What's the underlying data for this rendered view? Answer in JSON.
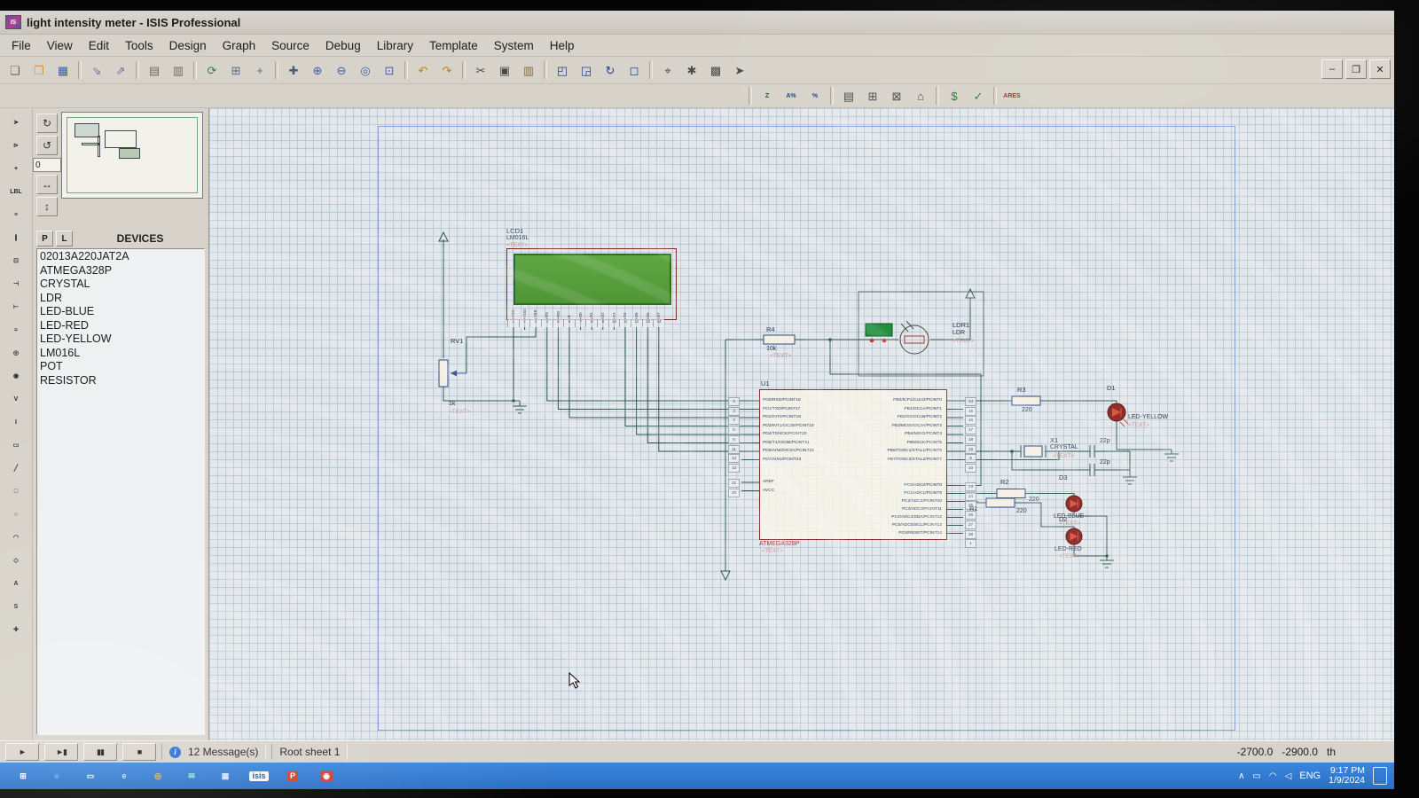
{
  "window": {
    "title": "light intensity meter - ISIS Professional",
    "app_badge": "IS",
    "min": "–",
    "max": "❐",
    "close": "✕"
  },
  "menu": [
    "File",
    "View",
    "Edit",
    "Tools",
    "Design",
    "Graph",
    "Source",
    "Debug",
    "Library",
    "Template",
    "System",
    "Help"
  ],
  "toolbar": {
    "g1": [
      {
        "n": "new-file-icon",
        "g": "❏",
        "c": "#6b675e"
      },
      {
        "n": "open-folder-icon",
        "g": "❐",
        "c": "#c89a35"
      },
      {
        "n": "save-icon",
        "g": "▦",
        "c": "#3f5fae"
      }
    ],
    "g2": [
      {
        "n": "import-icon",
        "g": "⇘",
        "c": "#7d68a8"
      },
      {
        "n": "export-icon",
        "g": "⇗",
        "c": "#7d68a8"
      }
    ],
    "g3": [
      {
        "n": "print-icon",
        "g": "▤",
        "c": "#6f6b61"
      },
      {
        "n": "mark-output-icon",
        "g": "▥",
        "c": "#6f6b61"
      }
    ],
    "g4": [
      {
        "n": "redraw-icon",
        "g": "⟳",
        "c": "#3f7a4f"
      },
      {
        "n": "grid-toggle-icon",
        "g": "⊞",
        "c": "#5a6a8a"
      },
      {
        "n": "false-origin-icon",
        "g": "+",
        "c": "#5a6a8a"
      }
    ],
    "g5": [
      {
        "n": "pan-icon",
        "g": "✚",
        "c": "#4a5a7a"
      },
      {
        "n": "zoom-in-icon",
        "g": "⊕",
        "c": "#3f5fae"
      },
      {
        "n": "zoom-out-icon",
        "g": "⊖",
        "c": "#3f5fae"
      },
      {
        "n": "zoom-all-icon",
        "g": "◎",
        "c": "#3f5fae"
      },
      {
        "n": "zoom-area-icon",
        "g": "⊡",
        "c": "#3f5fae"
      }
    ],
    "g6": [
      {
        "n": "undo-icon",
        "g": "↶",
        "c": "#b8860b"
      },
      {
        "n": "redo-icon",
        "g": "↷",
        "c": "#b8860b"
      }
    ],
    "g7": [
      {
        "n": "cut-icon",
        "g": "✂",
        "c": "#4a4a4a"
      },
      {
        "n": "copy-icon",
        "g": "▣",
        "c": "#4a4a4a"
      },
      {
        "n": "paste-icon",
        "g": "▥",
        "c": "#8a6d3b"
      }
    ],
    "g8": [
      {
        "n": "block-copy-icon",
        "g": "◰",
        "c": "#1f3f8f"
      },
      {
        "n": "block-move-icon",
        "g": "◲",
        "c": "#1f3f8f"
      },
      {
        "n": "block-rotate-icon",
        "g": "↻",
        "c": "#1f3f8f"
      },
      {
        "n": "block-delete-icon",
        "g": "◻",
        "c": "#1f3f8f"
      }
    ],
    "g9": [
      {
        "n": "pick-device-icon",
        "g": "⌖",
        "c": "#4a4a4a"
      },
      {
        "n": "make-device-icon",
        "g": "✱",
        "c": "#4a4a4a"
      },
      {
        "n": "packaging-tool-icon",
        "g": "▩",
        "c": "#4a4a4a"
      },
      {
        "n": "decompose-icon",
        "g": "➤",
        "c": "#4a4a4a"
      }
    ],
    "h1": [
      {
        "n": "wire-autorouter-icon",
        "g": "Z",
        "c": "#1f3f8f"
      },
      {
        "n": "search-tag-icon",
        "g": "A%",
        "c": "#1f3f8f"
      },
      {
        "n": "property-assignment-icon",
        "g": "%",
        "c": "#1f3f8f"
      }
    ],
    "h2": [
      {
        "n": "design-explorer-icon",
        "g": "▤",
        "c": "#4a4a4a"
      },
      {
        "n": "new-sheet-icon",
        "g": "⊞",
        "c": "#4a4a4a"
      },
      {
        "n": "remove-sheet-icon",
        "g": "⊠",
        "c": "#4a4a4a"
      },
      {
        "n": "goto-sheet-icon",
        "g": "⌂",
        "c": "#4a4a4a"
      }
    ],
    "h3": [
      {
        "n": "bill-of-materials-icon",
        "g": "$",
        "c": "#2a7a2a"
      },
      {
        "n": "electrical-check-icon",
        "g": "✓",
        "c": "#2a7a2a"
      }
    ],
    "h4": [
      {
        "n": "netlist-to-ares-icon",
        "g": "ARES",
        "c": "#b22222"
      }
    ]
  },
  "modes": [
    {
      "n": "selection-pointer-mode",
      "g": "➤"
    },
    {
      "n": "component-mode",
      "g": "⊳"
    },
    {
      "n": "junction-dot-mode",
      "g": "+"
    },
    {
      "n": "wire-label-mode",
      "g": "LBL"
    },
    {
      "n": "text-script-mode",
      "g": "≡"
    },
    {
      "n": "bus-mode",
      "g": "∥"
    },
    {
      "n": "subcircuit-mode",
      "g": "⊡"
    },
    {
      "n": "terminal-mode",
      "g": "⊣"
    },
    {
      "n": "device-pin-mode",
      "g": "⊢"
    },
    {
      "n": "graph-mode",
      "g": "≈"
    },
    {
      "n": "tape-recorder-mode",
      "g": "◎"
    },
    {
      "n": "generator-mode",
      "g": "◉"
    },
    {
      "n": "voltage-probe-mode",
      "g": "V"
    },
    {
      "n": "current-probe-mode",
      "g": "I"
    },
    {
      "n": "virtual-instruments-mode",
      "g": "▭"
    },
    {
      "n": "2d-line-mode",
      "g": "╱"
    },
    {
      "n": "2d-box-mode",
      "g": "□"
    },
    {
      "n": "2d-circle-mode",
      "g": "○"
    },
    {
      "n": "2d-arc-mode",
      "g": "◠"
    },
    {
      "n": "2d-path-mode",
      "g": "◇"
    },
    {
      "n": "2d-text-mode",
      "g": "A"
    },
    {
      "n": "2d-symbol-mode",
      "g": "S"
    },
    {
      "n": "marker-mode",
      "g": "✚"
    }
  ],
  "rotate": {
    "cw": "↻",
    "ccw": "↺",
    "angle": "0",
    "mirror_h": "↔",
    "mirror_v": "↕"
  },
  "devices_panel": {
    "p": "P",
    "l": "L",
    "header": "DEVICES",
    "items": [
      "02013A220JAT2A",
      "ATMEGA328P",
      "CRYSTAL",
      "LDR",
      "LED-BLUE",
      "LED-RED",
      "LED-YELLOW",
      "LM016L",
      "POT",
      "RESISTOR"
    ]
  },
  "schematic": {
    "lcd": {
      "ref": "LCD1",
      "value": "LM016L",
      "text": "<TEXT>",
      "pins": [
        {
          "l": "VSS",
          "n": "1"
        },
        {
          "l": "VDD",
          "n": "2"
        },
        {
          "l": "VEE",
          "n": "3"
        },
        {
          "l": "RS",
          "n": "4"
        },
        {
          "l": "RW",
          "n": "5"
        },
        {
          "l": "E",
          "n": "6"
        },
        {
          "l": "D0",
          "n": "7"
        },
        {
          "l": "D1",
          "n": "8"
        },
        {
          "l": "D2",
          "n": "9"
        },
        {
          "l": "D3",
          "n": "10"
        },
        {
          "l": "D4",
          "n": "11"
        },
        {
          "l": "D5",
          "n": "12"
        },
        {
          "l": "D6",
          "n": "13"
        },
        {
          "l": "D7",
          "n": "14"
        }
      ]
    },
    "mcu": {
      "ref": "U1",
      "value": "ATMEGA328P",
      "text": "<TEXT>",
      "left": [
        {
          "num": "2",
          "label": "PD0/RXD/PCINT16"
        },
        {
          "num": "3",
          "label": "PD1/TXD/PCINT17"
        },
        {
          "num": "4",
          "label": "PD2/INT0/PCINT18"
        },
        {
          "num": "5",
          "label": "PD3/INT1/OC2B/PCINT19"
        },
        {
          "num": "6",
          "label": "PD4/T0/XCK/PCINT20"
        },
        {
          "num": "11",
          "label": "PD5/T1/OC0B/PCINT21"
        },
        {
          "num": "12",
          "label": "PD6/AIN0/OC0A/PCINT22"
        },
        {
          "num": "13",
          "label": "PD7/AIN1/PCINT23"
        }
      ],
      "left2": [
        {
          "num": "21",
          "label": "AREF"
        },
        {
          "num": "20",
          "label": "AVCC"
        }
      ],
      "rightb": [
        {
          "num": "14",
          "label": "PB0/ICP1/CLKO/PCINT0"
        },
        {
          "num": "15",
          "label": "PB1/OC1A/PCINT1"
        },
        {
          "num": "16",
          "label": "PB2/SS/OC1B/PCINT2"
        },
        {
          "num": "17",
          "label": "PB3/MOSI/OC2A/PCINT3"
        },
        {
          "num": "18",
          "label": "PB4/MISO/PCINT4"
        },
        {
          "num": "19",
          "label": "PB5/SCK/PCINT5"
        },
        {
          "num": "9",
          "label": "PB6/TOSC1/XTAL1/PCINT6"
        },
        {
          "num": "10",
          "label": "PB7/TOSC2/XTAL2/PCINT7"
        }
      ],
      "rightc": [
        {
          "num": "23",
          "label": "PC0/ADC0/PCINT8"
        },
        {
          "num": "24",
          "label": "PC1/ADC1/PCINT9"
        },
        {
          "num": "25",
          "label": "PC2/ADC2/PCINT10"
        },
        {
          "num": "26",
          "label": "PC3/ADC3/PCINT11"
        },
        {
          "num": "27",
          "label": "PC4/ADC4/SDA/PCINT12"
        },
        {
          "num": "28",
          "label": "PC5/ADC5/SCL/PCINT13"
        },
        {
          "num": "1",
          "label": "PC6/RESET/PCINT14"
        }
      ]
    },
    "rv1": {
      "ref": "RV1",
      "value": "1k",
      "text": "<TEXT>"
    },
    "r4": {
      "ref": "R4",
      "value": "10k",
      "text": "<TEXT>"
    },
    "r3": {
      "ref": "R3",
      "value": "220"
    },
    "r2": {
      "ref": "R2",
      "value": "220"
    },
    "r1": {
      "ref": "R1",
      "value": "220"
    },
    "ldr": {
      "ref": "LDR1",
      "value": "LDR",
      "text": "<TEXT>"
    },
    "xtal": {
      "ref": "X1",
      "value": "CRYSTAL",
      "text": "<TEXT>"
    },
    "cap1": {
      "value": "22p"
    },
    "cap2": {
      "value": "22p"
    },
    "d1": {
      "ref": "D1",
      "value": "LED-YELLOW",
      "text": "<TEXT>"
    },
    "d3": {
      "ref": "D3",
      "value": "LED-BLUE",
      "text": "<TEXT>"
    },
    "d2": {
      "ref": "D2",
      "value": "LED-RED",
      "text": "<TEXT>"
    }
  },
  "sim": {
    "play": "►",
    "step": "►▮",
    "pause": "▮▮",
    "stop": "■"
  },
  "status": {
    "messages": "12 Message(s)",
    "sheet": "Root sheet 1",
    "x": "-2700.0",
    "y": "-2900.0",
    "units": "th"
  },
  "taskbar": {
    "items": [
      {
        "n": "start-button",
        "g": "⊞",
        "c": "#ffffff"
      },
      {
        "n": "search-icon",
        "g": "○",
        "c": "#ffffff"
      },
      {
        "n": "task-view-icon",
        "g": "▭",
        "c": "#ffffff"
      },
      {
        "n": "edge-browser-icon",
        "g": "e",
        "c": "#bfe6ff"
      },
      {
        "n": "browser-icon",
        "g": "◎",
        "c": "#f3c14b"
      },
      {
        "n": "mail-icon",
        "g": "✉",
        "c": "#9fe7dd"
      },
      {
        "n": "store-icon",
        "g": "▦",
        "c": "#d7e7ff"
      },
      {
        "n": "isis-taskbar-icon",
        "g": "isis",
        "c": "#1f4fae",
        "bg": "#f5f8ff"
      },
      {
        "n": "powerpoint-icon",
        "g": "P",
        "c": "#ffffff",
        "bg": "#c8432c"
      },
      {
        "n": "media-app-icon",
        "g": "◉",
        "c": "#ffffff",
        "bg": "#d03a3a"
      }
    ],
    "tray": [
      {
        "n": "tray-expand-icon",
        "g": "∧"
      },
      {
        "n": "battery-icon",
        "g": "▭"
      },
      {
        "n": "wifi-icon",
        "g": "◠"
      },
      {
        "n": "volume-icon",
        "g": "◁"
      }
    ],
    "lang": "ENG",
    "time": "9:17 PM",
    "date": "1/9/2024"
  }
}
